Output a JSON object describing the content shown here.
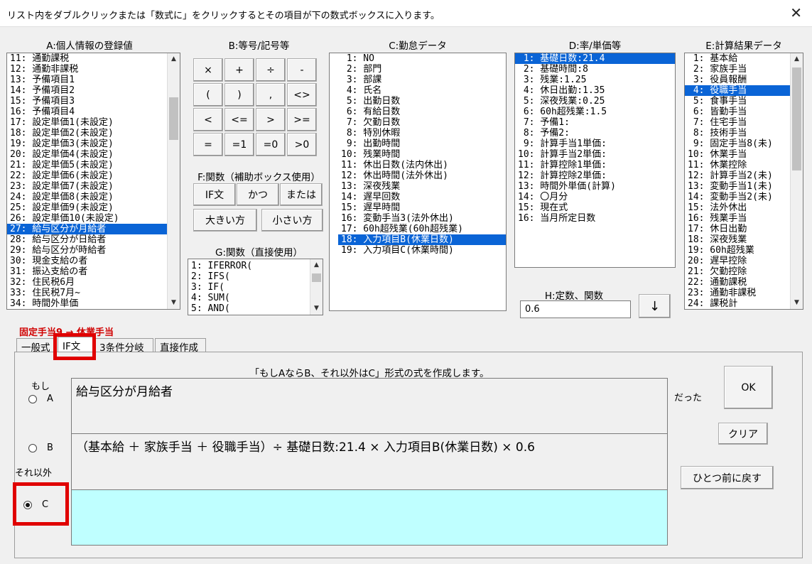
{
  "window": {
    "title": "リスト内をダブルクリックまたは「数式に」をクリックするとその項目が下の数式ボックスに入ります。",
    "close_label": "✕"
  },
  "listA": {
    "label": "A:個人情報の登録値",
    "items": [
      "11: 通勤課税",
      "12: 通勤非課税",
      "13: 予備項目1",
      "14: 予備項目2",
      "15: 予備項目3",
      "16: 予備項目4",
      "17: 設定単価1(未設定)",
      "18: 設定単価2(未設定)",
      "19: 設定単価3(未設定)",
      "20: 設定単価4(未設定)",
      "21: 設定単価5(未設定)",
      "22: 設定単価6(未設定)",
      "23: 設定単価7(未設定)",
      "24: 設定単価8(未設定)",
      "25: 設定単価9(未設定)",
      "26: 設定単価10(未設定)",
      "27: 給与区分が月給者",
      "28: 給与区分が日給者",
      "29: 給与区分が時給者",
      "30: 現金支給の者",
      "31: 振込支給の者",
      "32: 住民税6月",
      "33: 住民税7月~",
      "34: 時間外単価"
    ],
    "selected": "27: 給与区分が月給者"
  },
  "symbols": {
    "label": "B:等号/記号等",
    "buttons": [
      "×",
      "+",
      "÷",
      "-",
      "(",
      ")",
      ",",
      "<>",
      "<",
      "<=",
      ">",
      ">=",
      "=",
      "=1",
      "=0",
      ">0"
    ]
  },
  "functionsF": {
    "label": "F:関数（補助ボックス使用）",
    "if_label": "IF文",
    "and_label": "かつ",
    "or_label": "または",
    "max_label": "大きい方",
    "min_label": "小さい方"
  },
  "functionsG": {
    "label": "G:関数（直接使用）",
    "items": [
      "1: IFERROR(",
      "2: IFS(",
      "3: IF(",
      "4: SUM(",
      "5: AND("
    ]
  },
  "listC": {
    "label": "C:勤怠データ",
    "items": [
      " 1: NO",
      " 2: 部門",
      " 3: 部課",
      " 4: 氏名",
      " 5: 出勤日数",
      " 6: 有給日数",
      " 7: 欠勤日数",
      " 8: 特別休暇",
      " 9: 出勤時間",
      "10: 残業時間",
      "11: 休出日数(法内休出)",
      "12: 休出時間(法外休出)",
      "13: 深夜残業",
      "14: 遅早回数",
      "15: 遅早時間",
      "16: 変動手当3(法外休出)",
      "17: 60h超残業(60h超残業)",
      "18: 入力項目B(休業日数)",
      "19: 入力項目C(休業時間)"
    ],
    "selected": "18: 入力項目B(休業日数)"
  },
  "listD": {
    "label": "D:率/単価等",
    "items": [
      " 1: 基礎日数:21.4",
      " 2: 基礎時間:8",
      " 3: 残業:1.25",
      " 4: 休日出勤:1.35",
      " 5: 深夜残業:0.25",
      " 6: 60h超残業:1.5",
      " 7: 予備1:",
      " 8: 予備2:",
      " 9: 計算手当1単価:",
      "10: 計算手当2単価:",
      "11: 計算控除1単価:",
      "12: 計算控除2単価:",
      "13: 時間外単価(計算)",
      "14: 〇月分",
      "15: 現在式",
      "16: 当月所定日数"
    ],
    "selected": " 1: 基礎日数:21.4"
  },
  "constantH": {
    "label": "H:定数、関数",
    "value": "0.6",
    "down_button": "↓"
  },
  "listE": {
    "label": "E:計算結果データ",
    "items": [
      " 1: 基本給",
      " 2: 家族手当",
      " 3: 役員報酬",
      " 4: 役職手当",
      " 5: 食事手当",
      " 6: 皆勤手当",
      " 7: 住宅手当",
      " 8: 技術手当",
      " 9: 固定手当8(未)",
      "10: 休業手当",
      "11: 休業控除",
      "12: 計算手当2(未)",
      "13: 変動手当1(未)",
      "14: 変動手当2(未)",
      "15: 法外休出",
      "16: 残業手当",
      "17: 休日出勤",
      "18: 深夜残業",
      "19: 60h超残業",
      "20: 遅早控除",
      "21: 欠勤控除",
      "22: 通勤課税",
      "23: 通勤非課税",
      "24: 課税計"
    ],
    "selected": " 4: 役職手当"
  },
  "editing_target": "固定手当9 → 休業手当",
  "tabs": [
    "一般式",
    "IF文",
    "3条件分岐",
    "直接作成"
  ],
  "active_tab": "IF文",
  "if_panel": {
    "description": "「もしAならB、それ以外はC」形式の式を作成します。",
    "if_label": "もし",
    "else_label": "それ以外",
    "then_label": "だった",
    "radio_a": "A",
    "radio_b": "B",
    "radio_c": "C",
    "selected_radio": "C",
    "condition_a": "給与区分が月給者",
    "value_b": "（基本給 ＋ 家族手当 ＋ 役職手当）÷ 基礎日数:21.4 × 入力項目B(休業日数) × 0.6",
    "value_c": "",
    "ok_label": "OK",
    "clear_label": "クリア",
    "undo_label": "ひとつ前に戻す"
  },
  "colors": {
    "selection": "#0a64d6",
    "highlight_box": "#e00000",
    "formula_c_bg": "#bfffff",
    "editing_text": "#d00000"
  }
}
